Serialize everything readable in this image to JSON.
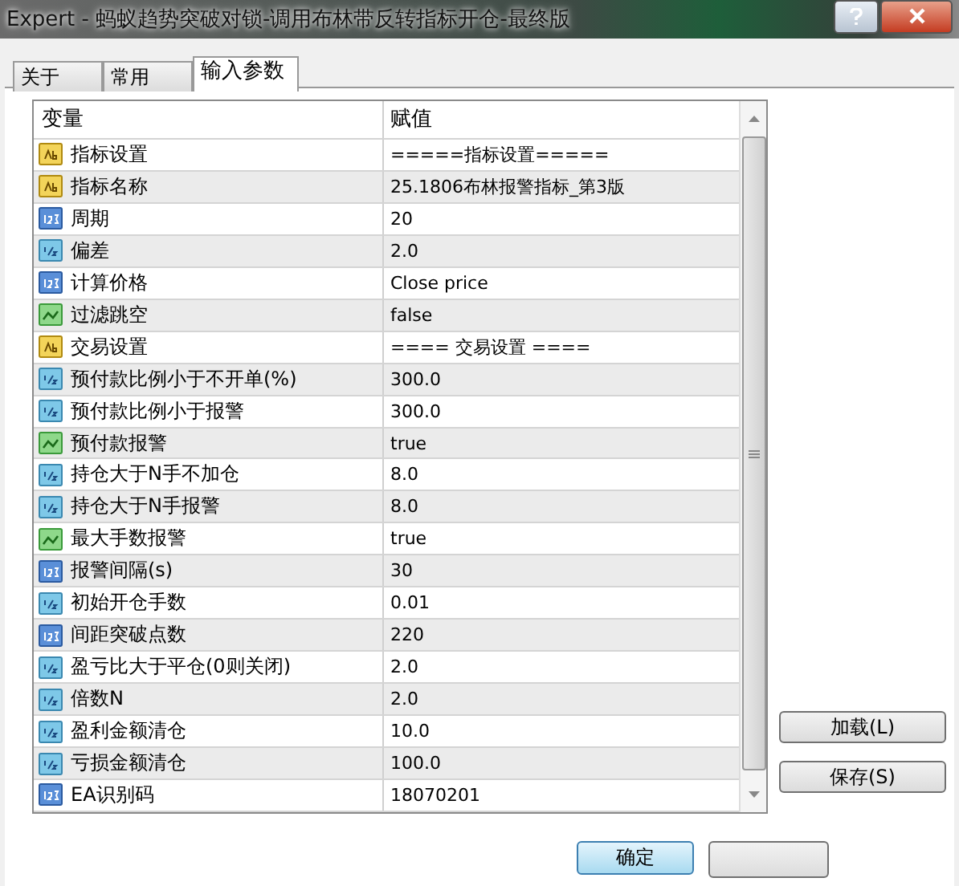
{
  "window": {
    "title": "Expert - 蚂蚁趋势突破对锁-调用布林带反转指标开仓-最终版"
  },
  "tabs": [
    {
      "label": "关于",
      "selected": false
    },
    {
      "label": "常用",
      "selected": false
    },
    {
      "label": "输入参数",
      "selected": true
    }
  ],
  "table": {
    "columns": [
      "变量",
      "赋值"
    ],
    "rows": [
      {
        "kind": "string",
        "name": "指标设置",
        "value": "=====指标设置====="
      },
      {
        "kind": "string",
        "name": "指标名称",
        "value": "25.1806布林报警指标_第3版"
      },
      {
        "kind": "int",
        "name": "周期",
        "value": "20"
      },
      {
        "kind": "double",
        "name": "偏差",
        "value": "2.0"
      },
      {
        "kind": "int",
        "name": "计算价格",
        "value": "Close price"
      },
      {
        "kind": "bool",
        "name": "过滤跳空",
        "value": "false"
      },
      {
        "kind": "string",
        "name": "交易设置",
        "value": "==== 交易设置 ===="
      },
      {
        "kind": "double",
        "name": "预付款比例小于不开单(%)",
        "value": "300.0"
      },
      {
        "kind": "double",
        "name": "预付款比例小于报警",
        "value": "300.0"
      },
      {
        "kind": "bool",
        "name": "预付款报警",
        "value": "true"
      },
      {
        "kind": "double",
        "name": "持仓大于N手不加仓",
        "value": "8.0"
      },
      {
        "kind": "double",
        "name": "持仓大于N手报警",
        "value": "8.0"
      },
      {
        "kind": "bool",
        "name": "最大手数报警",
        "value": "true"
      },
      {
        "kind": "int",
        "name": "报警间隔(s)",
        "value": "30"
      },
      {
        "kind": "double",
        "name": "初始开仓手数",
        "value": "0.01"
      },
      {
        "kind": "int",
        "name": "间距突破点数",
        "value": "220"
      },
      {
        "kind": "double",
        "name": "盈亏比大于平仓(0则关闭)",
        "value": "2.0"
      },
      {
        "kind": "double",
        "name": "倍数N",
        "value": "2.0"
      },
      {
        "kind": "double",
        "name": "盈利金额清仓",
        "value": "10.0"
      },
      {
        "kind": "double",
        "name": "亏损金额清仓",
        "value": "100.0"
      },
      {
        "kind": "int",
        "name": "EA识别码",
        "value": "18070201"
      }
    ]
  },
  "side_buttons": [
    "加载(L)",
    "保存(S)"
  ],
  "footer_buttons": [
    "确定"
  ]
}
